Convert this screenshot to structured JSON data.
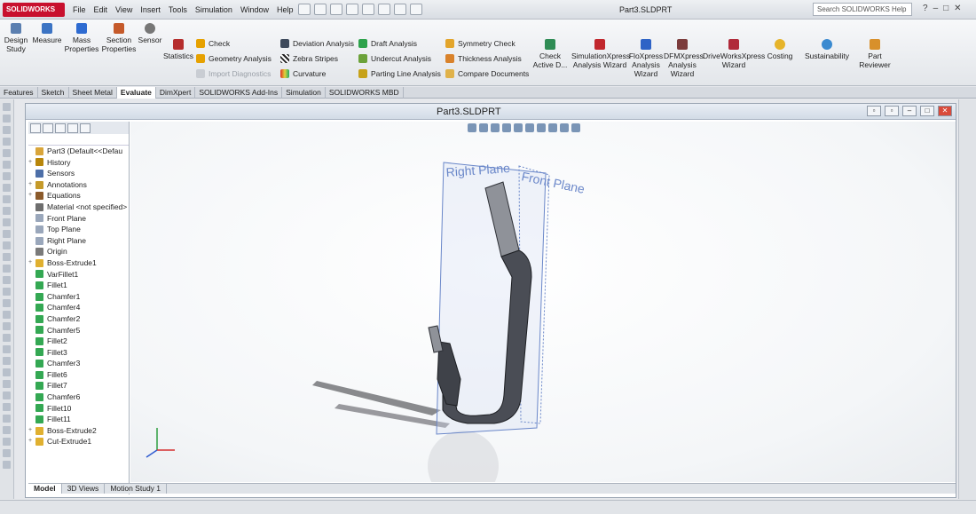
{
  "app": {
    "logo_text": "SOLIDWORKS",
    "window_title": "Part3.SLDPRT"
  },
  "menu": [
    "File",
    "Edit",
    "View",
    "Insert",
    "Tools",
    "Simulation",
    "Window",
    "Help"
  ],
  "search": {
    "placeholder": "Search SOLIDWORKS Help"
  },
  "commands": {
    "design_study": "Design Study",
    "measure": "Measure",
    "mass_properties": "Mass Properties",
    "section_properties": "Section Properties",
    "sensor": "Sensor",
    "statistics": "Statistics",
    "check": "Check",
    "geometry_analysis": "Geometry Analysis",
    "import_diagnostics": "Import Diagnostics",
    "deviation_analysis": "Deviation Analysis",
    "zebra_stripes": "Zebra Stripes",
    "curvature": "Curvature",
    "draft_analysis": "Draft Analysis",
    "undercut_analysis": "Undercut Analysis",
    "parting_line_analysis": "Parting Line Analysis",
    "symmetry_check": "Symmetry Check",
    "thickness_analysis": "Thickness Analysis",
    "compare_documents": "Compare Documents",
    "check_active": "Check Active D...",
    "simulationxpress": "SimulationXpress Analysis Wizard",
    "floxpress": "FloXpress Analysis Wizard",
    "dfmxpress": "DFMXpress Analysis Wizard",
    "driveworksxpress": "DriveWorksXpress Wizard",
    "costing": "Costing",
    "sustainability": "Sustainability",
    "part_reviewer": "Part Reviewer"
  },
  "cmd_tabs": [
    "Features",
    "Sketch",
    "Sheet Metal",
    "Evaluate",
    "DimXpert",
    "SOLIDWORKS Add-Ins",
    "Simulation",
    "SOLIDWORKS MBD"
  ],
  "active_cmd_tab": "Evaluate",
  "document": {
    "title": "Part3.SLDPRT"
  },
  "tree": [
    {
      "label": "Part3  (Default<<Defau",
      "icon": "part-icon",
      "expand": ""
    },
    {
      "label": "History",
      "icon": "history-icon",
      "expand": "+"
    },
    {
      "label": "Sensors",
      "icon": "sensors-icon",
      "expand": ""
    },
    {
      "label": "Annotations",
      "icon": "annotations-icon",
      "expand": "+"
    },
    {
      "label": "Equations",
      "icon": "equations-icon",
      "expand": "+"
    },
    {
      "label": "Material <not specified>",
      "icon": "material-icon",
      "expand": ""
    },
    {
      "label": "Front Plane",
      "icon": "plane-icon",
      "expand": ""
    },
    {
      "label": "Top Plane",
      "icon": "plane-icon",
      "expand": ""
    },
    {
      "label": "Right Plane",
      "icon": "plane-icon",
      "expand": ""
    },
    {
      "label": "Origin",
      "icon": "origin-icon",
      "expand": ""
    },
    {
      "label": "Boss-Extrude1",
      "icon": "feature-icon",
      "expand": "+"
    },
    {
      "label": "VarFillet1",
      "icon": "fillet-icon",
      "expand": ""
    },
    {
      "label": "Fillet1",
      "icon": "fillet-icon",
      "expand": ""
    },
    {
      "label": "Chamfer1",
      "icon": "chamfer-icon",
      "expand": ""
    },
    {
      "label": "Chamfer4",
      "icon": "chamfer-icon",
      "expand": ""
    },
    {
      "label": "Chamfer2",
      "icon": "chamfer-icon",
      "expand": ""
    },
    {
      "label": "Chamfer5",
      "icon": "chamfer-icon",
      "expand": ""
    },
    {
      "label": "Fillet2",
      "icon": "fillet-icon",
      "expand": ""
    },
    {
      "label": "Fillet3",
      "icon": "fillet-icon",
      "expand": ""
    },
    {
      "label": "Chamfer3",
      "icon": "chamfer-icon",
      "expand": ""
    },
    {
      "label": "Fillet6",
      "icon": "fillet-icon",
      "expand": ""
    },
    {
      "label": "Fillet7",
      "icon": "fillet-icon",
      "expand": ""
    },
    {
      "label": "Chamfer6",
      "icon": "chamfer-icon",
      "expand": ""
    },
    {
      "label": "Fillet10",
      "icon": "fillet-icon",
      "expand": ""
    },
    {
      "label": "Fillet11",
      "icon": "fillet-icon",
      "expand": ""
    },
    {
      "label": "Boss-Extrude2",
      "icon": "feature-icon",
      "expand": "+"
    },
    {
      "label": "Cut-Extrude1",
      "icon": "cut-icon",
      "expand": "+"
    }
  ],
  "bottom_tabs": [
    "Model",
    "3D Views",
    "Motion Study 1"
  ],
  "active_bottom_tab": "Model",
  "planes": {
    "right": "Right Plane",
    "front": "Front Plane"
  },
  "colors": {
    "brand": "#c8102e",
    "plane": "#6a87c9",
    "part": "#4a4d55",
    "fillet_icon": "#34a853"
  }
}
